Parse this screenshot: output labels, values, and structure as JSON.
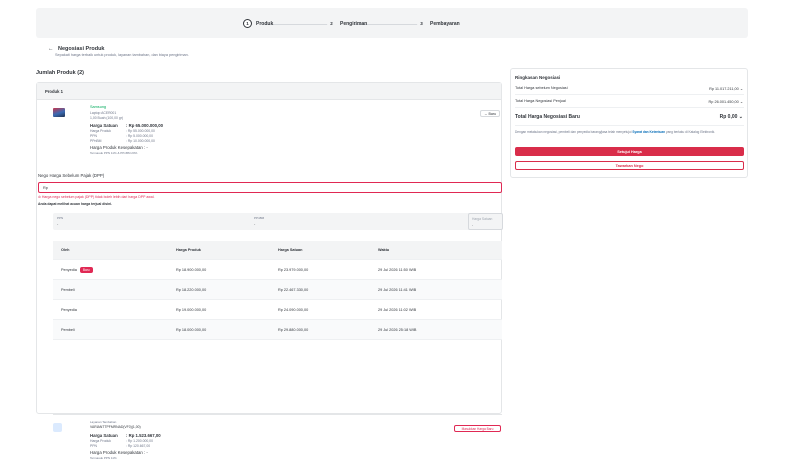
{
  "stepper": {
    "steps": [
      {
        "num": "1",
        "label": "Produk"
      },
      {
        "num": "2",
        "label": "Pengiriman"
      },
      {
        "num": "3",
        "label": "Pembayaran"
      }
    ]
  },
  "header": {
    "back_arrow": "←",
    "title": "Negosiasi Produk",
    "subtitle": "Sepakati harga terbaik untuk produk, layanan tambahan, dan biaya pengiriman."
  },
  "jumlah_produk": "Jumlah Produk (2)",
  "product_card": {
    "header": "Produk 1",
    "product": {
      "name": "Samsung",
      "variant": "Laptop ACER001",
      "qty": "1,00 Buah (100,00 gr)",
      "baru_label": "Baru",
      "baru_arrow": "↔",
      "harga_satuan_label": "Harga Satuan",
      "harga_satuan_value": ": Rp 65.000.000,00",
      "harga_produk_label": "Harga Produk",
      "harga_produk_value": ": Rp 55.000.000,00",
      "ppn_label": "PPN",
      "ppn_value": ": Rp 5.000.000,00",
      "ppnbm_label": "PPnBM",
      "ppnbm_value": ": Rp 10.000.000,00",
      "kesepakatan_label": "Harga Produk Kesepakatan",
      "kesepakatan_value": ": -",
      "kesepakatan_note": "Termasuk PPN 11% & PPnBM 20%"
    },
    "nego_label": "Nego Harga Sebelum Pajak (DPP)",
    "nego_input_value": "Rp",
    "nego_error": "Harga nego sebelum pajak (DPP) tidak boleh lebih dari harga DPP awal.",
    "nego_hint": "Anda dapat melihat acuan harga terjual disini.",
    "ppn_field": {
      "label": "PPN",
      "value": "-"
    },
    "ppnbm_field": {
      "label": "PPnBM",
      "value": "-"
    },
    "harga_baru": {
      "label": "Harga Satuan",
      "value": "-"
    },
    "table": {
      "headers": [
        "Oleh",
        "Harga Produk",
        "Harga Satuan",
        "Waktu"
      ],
      "rows": [
        {
          "oleh": "Penyedia",
          "badge": "Baru",
          "harga_produk": "Rp 18.900.000,00",
          "harga_satuan": "Rp 23.979.000,00",
          "waktu": "29 Jul 2026 11:50 WIB"
        },
        {
          "oleh": "Pembeli",
          "badge": "",
          "harga_produk": "Rp 18.220.000,00",
          "harga_satuan": "Rp 22.467.330,00",
          "waktu": "29 Jul 2026 11:41 WIB"
        },
        {
          "oleh": "Penyedia",
          "badge": "",
          "harga_produk": "Rp 19.000.000,00",
          "harga_satuan": "Rp 24.090.000,00",
          "waktu": "29 Jul 2026 11:02 WIB"
        },
        {
          "oleh": "Pembeli",
          "badge": "",
          "harga_produk": "Rp 18.000.000,00",
          "harga_satuan": "Rp 29.880.000,00",
          "waktu": "29 Jul 2026 25:18 WIB"
        }
      ]
    },
    "addon": {
      "title": "Layanan Tambahan",
      "name": "VARIANTTPFMRNAD(VF0)(1,00)",
      "button": "Masukkan Harga Baru",
      "harga_satuan_label": "Harga Satuan",
      "harga_satuan_value": ": Rp 1.523.667,00",
      "harga_produk_label": "Harga Produk",
      "harga_produk_value": ": Rp 1.200.000,00",
      "ppn_label": "PPN",
      "ppn_value": ": Rp 120.667,00",
      "kesepakatan_label": "Harga Produk Kesepakatan",
      "kesepakatan_value": ": -",
      "kesepakatan_note": "Termasuk PPN 11%"
    }
  },
  "summary": {
    "title": "Ringkasan Negosiasi",
    "rows": [
      {
        "label": "Total Harga sebelum Negosiasi",
        "value": "Rp 11.017.211,00",
        "chevron": "⌄"
      },
      {
        "label": "Total Harga Negosiasi Penjual",
        "value": "Rp 26.001.450,00",
        "chevron": "⌄"
      }
    ],
    "total_label": "Total Harga Negosiasi Baru",
    "total_value": "Rp 0,00",
    "total_chevron": "⌄",
    "disclaimer_a": "Dengan melakukan negosiasi, pembeli dan penyedia barang/jasa telah menyetujui",
    "disclaimer_link1": "Syarat dan Ketentuan",
    "disclaimer_b": "yang berlaku",
    "disclaimer_c": "di Katalog Elektronik.",
    "accept_button": "Setujui Harga",
    "nego_button": "Tawarkan Nego"
  }
}
